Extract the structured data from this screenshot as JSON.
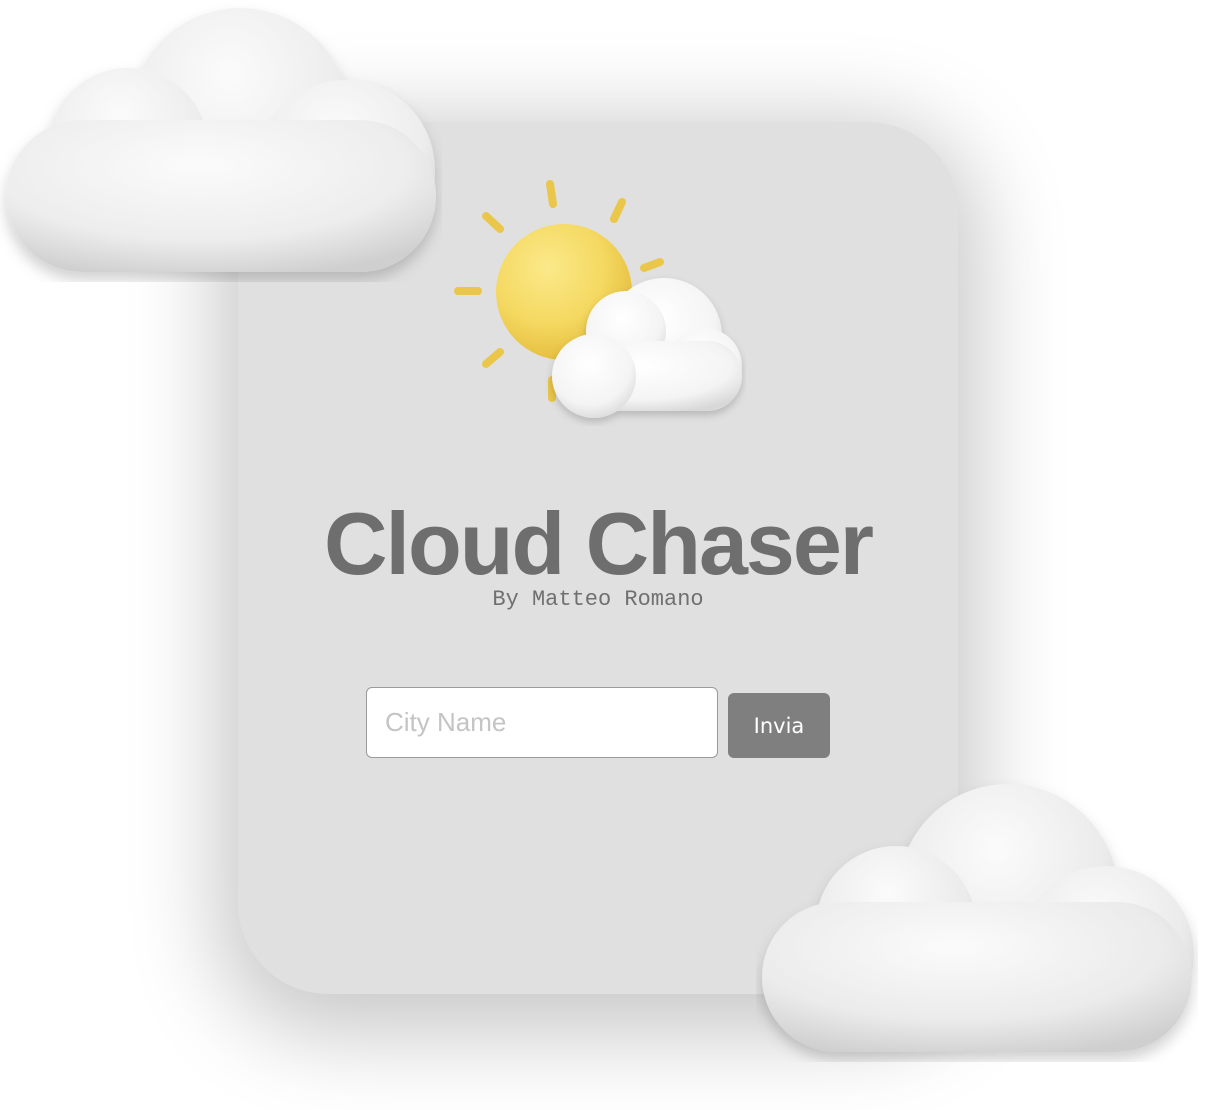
{
  "app": {
    "title": "Cloud Chaser",
    "subtitle": "By Matteo Romano"
  },
  "search": {
    "placeholder": "City Name",
    "value": ""
  },
  "actions": {
    "submit_label": "Invia"
  },
  "icons": {
    "hero": "sun-behind-cloud-icon",
    "decor_left": "cloud-icon",
    "decor_right": "cloud-icon"
  },
  "colors": {
    "card_background": "#e0e0e0",
    "title_text": "#6e6e6e",
    "button_background": "#7f7f7f",
    "sun": "#f4d860"
  }
}
